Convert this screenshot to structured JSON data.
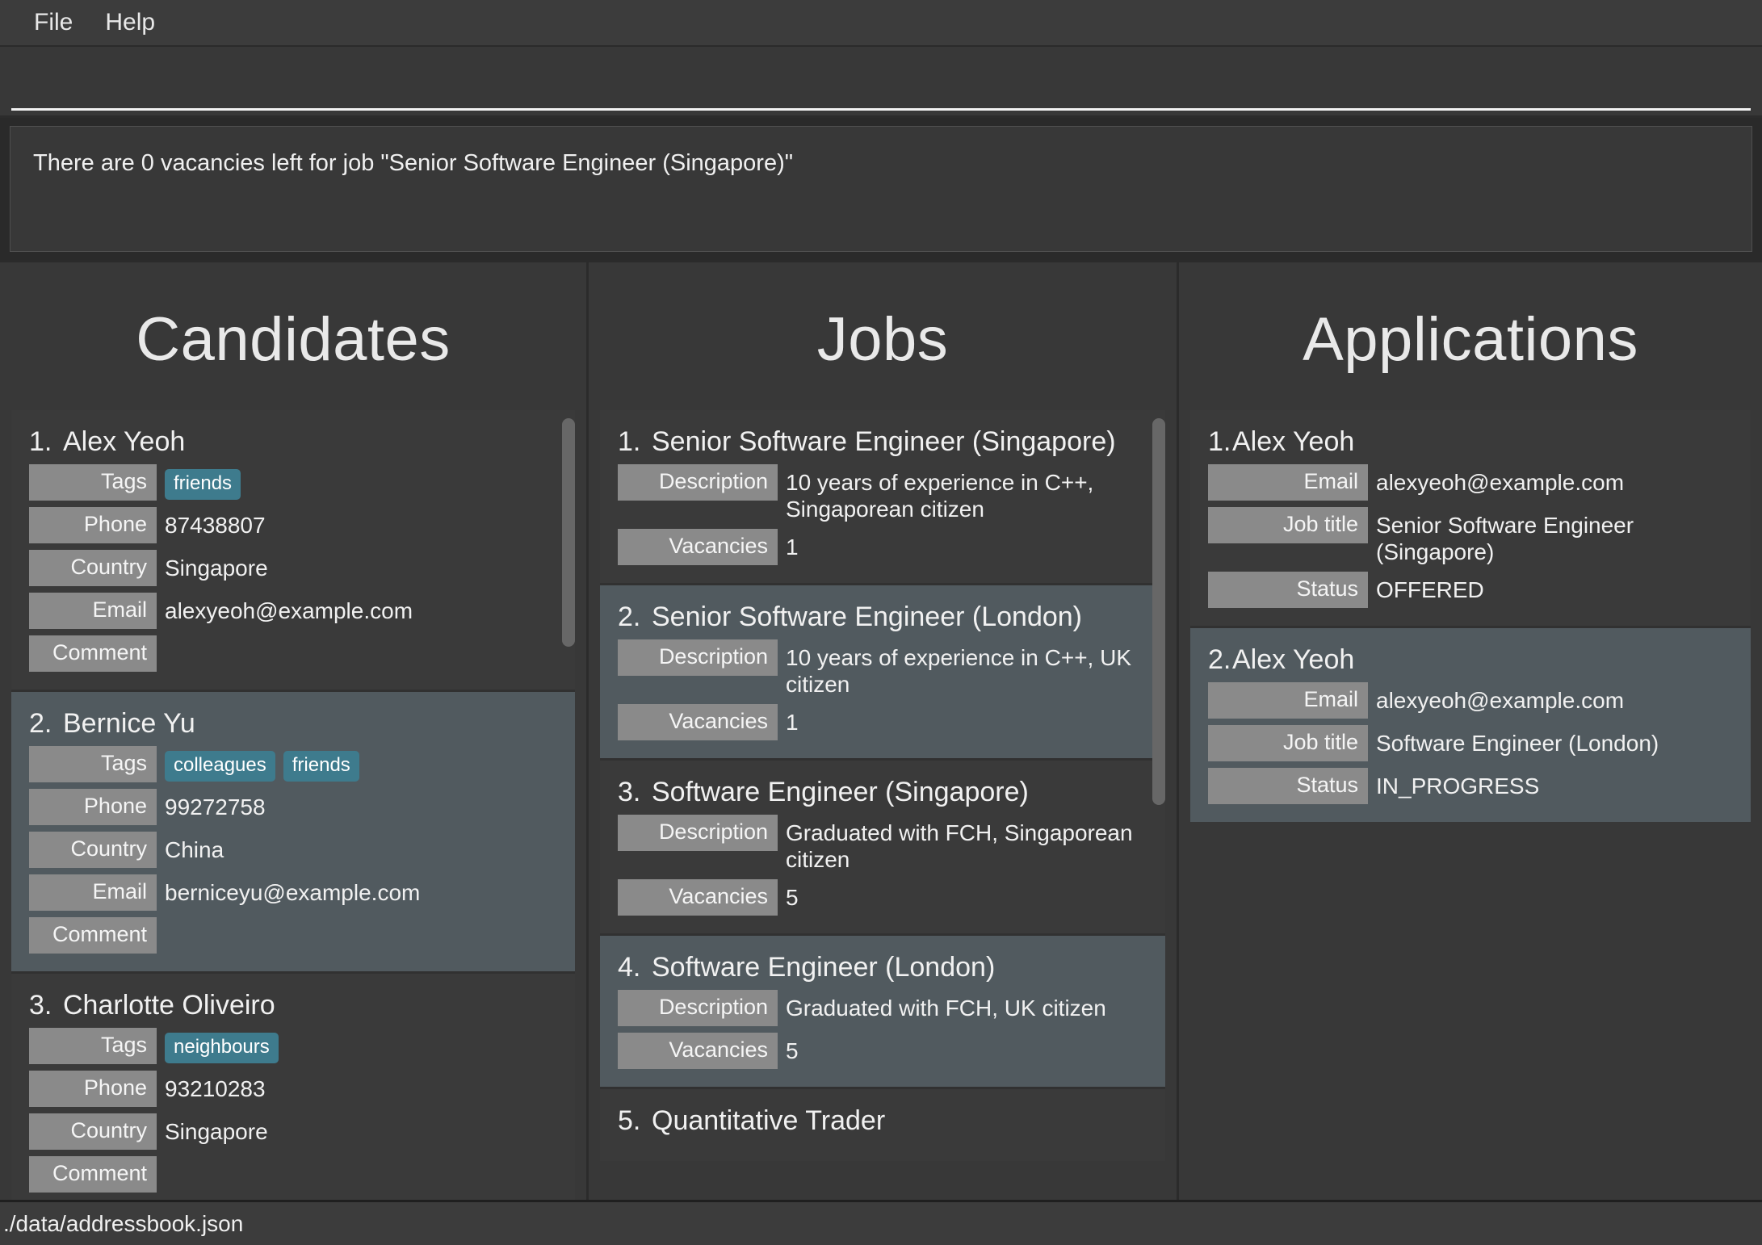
{
  "menu": {
    "items": [
      {
        "label": "File"
      },
      {
        "label": "Help"
      }
    ]
  },
  "command": {
    "value": "",
    "placeholder": ""
  },
  "result_display": {
    "text": "There are 0 vacancies left for job \"Senior Software Engineer (Singapore)\""
  },
  "colors": {
    "window_bg": "#383838",
    "card_bg": "#3a3a3a",
    "card_selected_bg": "#515a5f",
    "field_label_bg": "#8a8a8a",
    "tag_bg": "#3e7b8d",
    "text": "#f1f1f1",
    "divider": "#2b2b2b",
    "scroll_thumb": "#676767",
    "command_underline": "#f2f2f2"
  },
  "panels": {
    "candidates": {
      "title": "Candidates",
      "labels": {
        "tags": "Tags",
        "phone": "Phone",
        "country": "Country",
        "email": "Email",
        "comment": "Comment"
      },
      "items": [
        {
          "index": "1.",
          "name": "Alex Yeoh",
          "selected": false,
          "tags": [
            "friends"
          ],
          "phone": "87438807",
          "country": "Singapore",
          "email": "alexyeoh@example.com",
          "comment": ""
        },
        {
          "index": "2.",
          "name": "Bernice Yu",
          "selected": true,
          "tags": [
            "colleagues",
            "friends"
          ],
          "phone": "99272758",
          "country": "China",
          "email": "berniceyu@example.com",
          "comment": ""
        },
        {
          "index": "3.",
          "name": "Charlotte Oliveiro",
          "selected": false,
          "tags": [
            "neighbours"
          ],
          "phone": "93210283",
          "country": "Singapore",
          "email": "",
          "comment": ""
        }
      ],
      "scroll": {
        "thumb_top_pct": 1,
        "thumb_height_pct": 29
      }
    },
    "jobs": {
      "title": "Jobs",
      "labels": {
        "description": "Description",
        "vacancies": "Vacancies"
      },
      "items": [
        {
          "index": "1.",
          "title": "Senior Software Engineer (Singapore)",
          "selected": false,
          "description": "10 years of experience in C++, Singaporean citizen",
          "vacancies": "1"
        },
        {
          "index": "2.",
          "title": "Senior Software Engineer (London)",
          "selected": true,
          "description": "10 years of experience in C++, UK citizen",
          "vacancies": "1"
        },
        {
          "index": "3.",
          "title": "Software Engineer (Singapore)",
          "selected": false,
          "description": "Graduated with FCH, Singaporean citizen",
          "vacancies": "5"
        },
        {
          "index": "4.",
          "title": "Software Engineer (London)",
          "selected": true,
          "description": "Graduated with FCH, UK citizen",
          "vacancies": "5"
        },
        {
          "index": "5.",
          "title": "Quantitative Trader",
          "selected": false,
          "description": "",
          "vacancies": ""
        }
      ],
      "scroll": {
        "thumb_top_pct": 1,
        "thumb_height_pct": 49
      }
    },
    "applications": {
      "title": "Applications",
      "labels": {
        "email": "Email",
        "job_title": "Job title",
        "status": "Status"
      },
      "items": [
        {
          "index": "1.",
          "name": "Alex Yeoh",
          "selected": false,
          "email": "alexyeoh@example.com",
          "job_title": "Senior Software Engineer (Singapore)",
          "status": "OFFERED"
        },
        {
          "index": "2.",
          "name": "Alex Yeoh",
          "selected": true,
          "email": "alexyeoh@example.com",
          "job_title": "Software Engineer (London)",
          "status": "IN_PROGRESS"
        }
      ]
    }
  },
  "status_bar": {
    "save_location": "./data/addressbook.json"
  }
}
